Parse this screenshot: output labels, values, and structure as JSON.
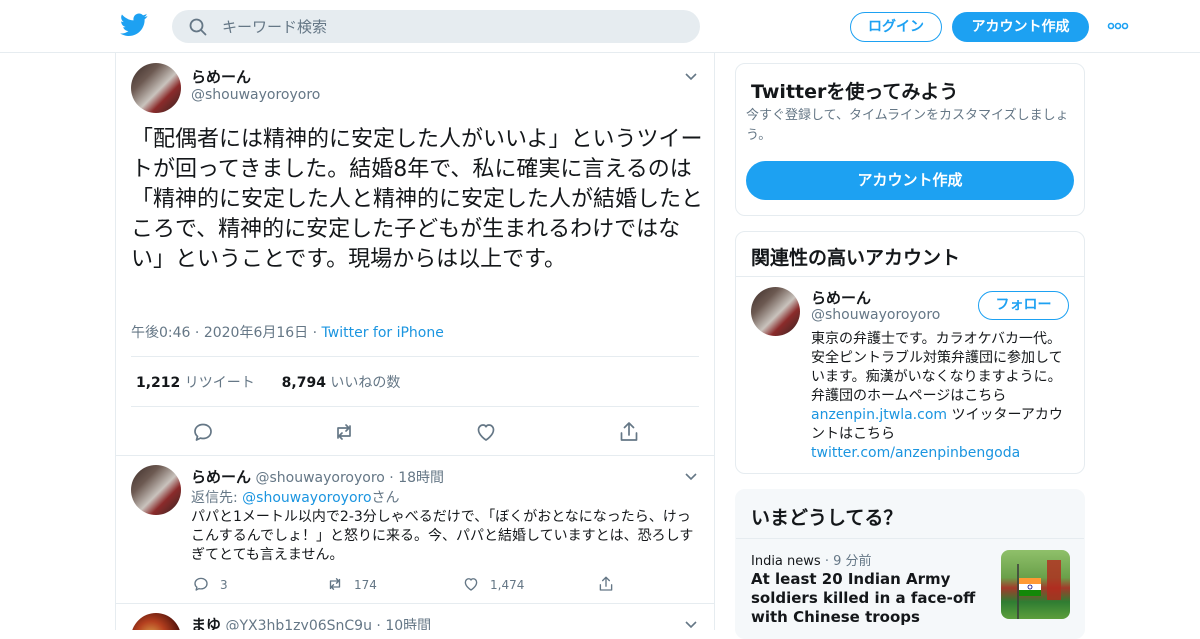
{
  "header": {
    "search_placeholder": "キーワード検索",
    "login_label": "ログイン",
    "signup_label": "アカウント作成"
  },
  "main_tweet": {
    "name": "らめーん",
    "handle": "@shouwayoroyoro",
    "text": "「配偶者には精神的に安定した人がいいよ」というツイートが回ってきました。結婚8年で、私に確実に言えるのは「精神的に安定した人と精神的に安定した人が結婚したところで、精神的に安定した子どもが生まれるわけではない」ということです。現場からは以上です。",
    "time": "午後0:46",
    "date": "2020年6月16日",
    "source": "Twitter for iPhone",
    "retweets_count": "1,212",
    "retweets_label": "リツイート",
    "likes_count": "8,794",
    "likes_label": "いいねの数"
  },
  "replies": [
    {
      "name": "らめーん",
      "handle": "@shouwayoroyoro",
      "time": "18時間",
      "reply_prefix": "返信先: ",
      "reply_to": "@shouwayoroyoro",
      "reply_suffix": "さん",
      "text": "パパと1メートル以内で2-3分しゃべるだけで、「ぼくがおとなになったら、けっこんするんでしょ！」と怒りに来る。今、パパと結婚していますとは、恐ろしすぎてとても言えません。",
      "reply_count": "3",
      "retweet_count": "174",
      "like_count": "1,474"
    },
    {
      "name": "まゆ",
      "handle": "@YX3hb1zy06SnC9u",
      "time": "10時間"
    }
  ],
  "signup_card": {
    "title": "Twitterを使ってみよう",
    "subtitle": "今すぐ登録して、タイムラインをカスタマイズしましょう。",
    "button_label": "アカウント作成"
  },
  "related_card": {
    "title": "関連性の高いアカウント",
    "name": "らめーん",
    "handle": "@shouwayoroyoro",
    "follow_label": "フォロー",
    "bio_1": "東京の弁護士です。カラオケバカ一代。 安全ピントラブル対策弁護団に参加しています。痴漢がいなくなりますように。 弁護団のホームページはこちら",
    "bio_link_1": "anzenpin.jtwla.com",
    "bio_2": " ツイッターアカウントはこちら",
    "bio_link_2": "twitter.com/anzenpinbengoda"
  },
  "trends_card": {
    "title": "いまどうしてる？",
    "source": "India news",
    "time": "9 分前",
    "headline": "At least 20 Indian Army soldiers killed in a face-off with Chinese troops"
  },
  "colors": {
    "accent": "#1da1f2",
    "link": "#1b95e0",
    "secondary_text": "#657786",
    "border": "#e6ecf0"
  },
  "icons": [
    "twitter-bird-icon",
    "search-icon",
    "more-dots-icon",
    "chevron-down-icon",
    "reply-icon",
    "retweet-icon",
    "like-icon",
    "share-icon"
  ]
}
